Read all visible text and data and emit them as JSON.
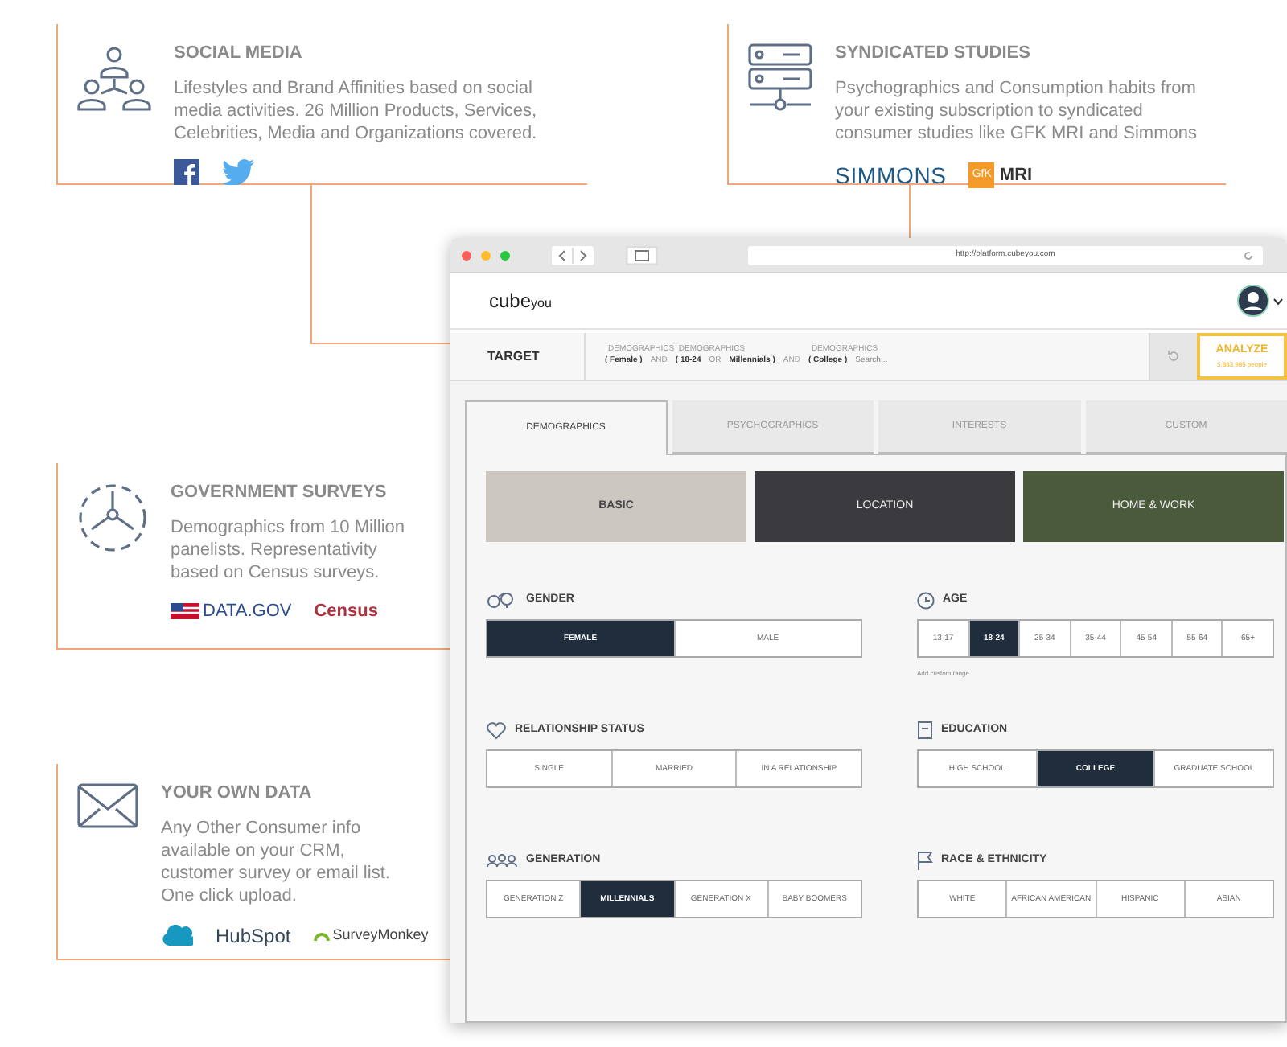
{
  "cards": [
    {
      "kind": "social",
      "title": "SOCIAL MEDIA",
      "text": "Lifestyles and Brand Affinities based on social media activities. 26 Million Products, Services, Celebrities, Media and Organizations covered.",
      "logos": [
        {
          "kind": "facebook"
        },
        {
          "kind": "twitter"
        }
      ]
    },
    {
      "kind": "syndicated",
      "title": "SYNDICATED STUDIES",
      "text": "Psychographics and Consumption habits from your existing subscription to syndicated consumer studies like GFK MRI and Simmons",
      "logos": [
        {
          "kind": "simmons",
          "text": "SIMMONS"
        },
        {
          "kind": "gfk",
          "badge": "GfK",
          "text": "MRI"
        }
      ]
    },
    {
      "kind": "government",
      "title": "GOVERNMENT SURVEYS",
      "text": "Demographics from 10 Million panelists. Representativity based on Census surveys.",
      "logos": [
        {
          "kind": "datagov",
          "text": "DATA.GOV"
        },
        {
          "kind": "census",
          "text": "Census"
        }
      ]
    },
    {
      "kind": "own",
      "title": "YOUR OWN DATA",
      "text": "Any Other Consumer info available on your CRM, customer survey or email list. One click upload.",
      "logos": [
        {
          "kind": "salesforce"
        },
        {
          "kind": "hubspot",
          "text": "HubSpot"
        },
        {
          "kind": "surveymonkey",
          "text": "SurveyMonkey"
        }
      ]
    }
  ],
  "browser": {
    "url": "http://platform.cubeyou.com",
    "logo": {
      "main": "cube",
      "sub": "you"
    },
    "target_label": "TARGET",
    "query": [
      {
        "kind": "term",
        "category": "DEMOGRAPHICS",
        "text": "( Female )"
      },
      {
        "kind": "op",
        "text": "AND"
      },
      {
        "kind": "term",
        "category": "DEMOGRAPHICS",
        "text": "( 18-24"
      },
      {
        "kind": "op",
        "text": "OR"
      },
      {
        "kind": "term",
        "text": "Millennials )"
      },
      {
        "kind": "op",
        "text": "AND"
      },
      {
        "kind": "term",
        "category": "DEMOGRAPHICS",
        "text": "( College )"
      }
    ],
    "search_placeholder": "Search...",
    "analyze": {
      "label": "ANALYZE",
      "count": "5,883,985 people"
    },
    "tabs": [
      {
        "label": "DEMOGRAPHICS",
        "selected": true
      },
      {
        "label": "PSYCHOGRAPHICS",
        "selected": false
      },
      {
        "label": "INTERESTS",
        "selected": false
      },
      {
        "label": "CUSTOM",
        "selected": false
      }
    ],
    "tiles": [
      {
        "label": "BASIC",
        "selected": true
      },
      {
        "label": "LOCATION",
        "selected": false
      },
      {
        "label": "HOME & WORK",
        "selected": false
      }
    ],
    "sections": [
      {
        "kind": "gender",
        "title": "GENDER",
        "options": [
          {
            "label": "FEMALE",
            "selected": true
          },
          {
            "label": "MALE",
            "selected": false
          }
        ]
      },
      {
        "kind": "age",
        "title": "AGE",
        "options": [
          {
            "label": "13-17",
            "selected": false
          },
          {
            "label": "18-24",
            "selected": true
          },
          {
            "label": "25-34",
            "selected": false
          },
          {
            "label": "35-44",
            "selected": false
          },
          {
            "label": "45-54",
            "selected": false
          },
          {
            "label": "55-64",
            "selected": false
          },
          {
            "label": "65+",
            "selected": false
          }
        ],
        "link": "Add custom range"
      },
      {
        "kind": "relationship",
        "title": "RELATIONSHIP STATUS",
        "options": [
          {
            "label": "SINGLE",
            "selected": false
          },
          {
            "label": "MARRIED",
            "selected": false
          },
          {
            "label": "IN A RELATIONSHIP",
            "selected": false
          }
        ]
      },
      {
        "kind": "education",
        "title": "EDUCATION",
        "options": [
          {
            "label": "HIGH SCHOOL",
            "selected": false
          },
          {
            "label": "COLLEGE",
            "selected": true
          },
          {
            "label": "GRADUATE SCHOOL",
            "selected": false
          }
        ]
      },
      {
        "kind": "generation",
        "title": "GENERATION",
        "options": [
          {
            "label": "GENERATION Z",
            "selected": false
          },
          {
            "label": "MILLENNIALS",
            "selected": true
          },
          {
            "label": "GENERATION X",
            "selected": false
          },
          {
            "label": "BABY BOOMERS",
            "selected": false
          }
        ]
      },
      {
        "kind": "race",
        "title": "RACE & ETHNICITY",
        "options": [
          {
            "label": "WHITE",
            "selected": false
          },
          {
            "label": "AFRICAN AMERICAN",
            "selected": false
          },
          {
            "label": "HISPANIC",
            "selected": false
          },
          {
            "label": "ASIAN",
            "selected": false
          }
        ]
      }
    ]
  }
}
